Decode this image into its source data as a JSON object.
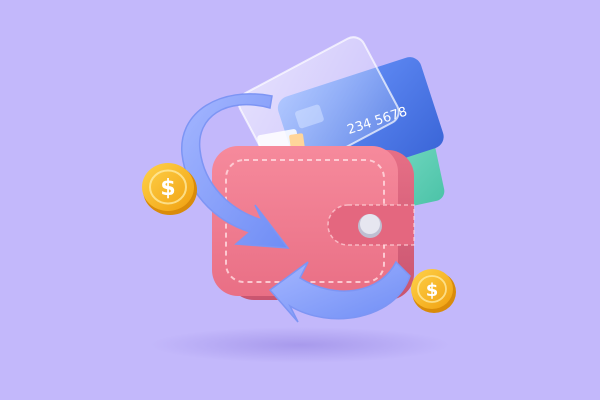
{
  "illustration": {
    "subject": "wallet-cashback",
    "card_number_fragment": "234 5678",
    "currency_symbol": "$",
    "colors": {
      "background": "#c3b8fb",
      "wallet": "#f07f92",
      "wallet_shadow": "#d9647a",
      "wallet_stitch": "#ffd7dd",
      "card_blue": "#4f7ff0",
      "card_green": "#5ed3b8",
      "arrow": "#8ea4ff",
      "coin": "#f6b21b",
      "coin_edge": "#d98b0a",
      "clasp": "#d8d8e8"
    },
    "icons": [
      "wallet-icon",
      "credit-card-icon",
      "cycle-arrow-icon",
      "dollar-coin-icon"
    ]
  }
}
